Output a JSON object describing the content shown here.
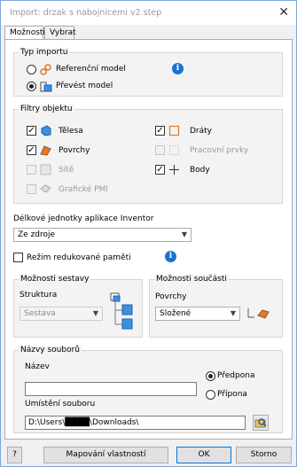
{
  "window": {
    "title": "Import: drzak s nabojnicemi v2.step"
  },
  "tabs": [
    {
      "label": "Možnosti"
    },
    {
      "label": "Vybrat"
    }
  ],
  "import_type": {
    "label": "Typ importu",
    "options": [
      {
        "label": "Referenční model",
        "selected": false
      },
      {
        "label": "Převést model",
        "selected": true
      }
    ]
  },
  "object_filters": {
    "label": "Filtry objektu",
    "items": [
      {
        "label": "Tělesa",
        "checked": true,
        "enabled": true
      },
      {
        "label": "Povrchy",
        "checked": true,
        "enabled": true
      },
      {
        "label": "Sítě",
        "checked": false,
        "enabled": false
      },
      {
        "label": "Grafické PMI",
        "checked": false,
        "enabled": false
      },
      {
        "label": "Dráty",
        "checked": true,
        "enabled": true
      },
      {
        "label": "Pracovní prvky",
        "checked": false,
        "enabled": false
      },
      {
        "label": "Body",
        "checked": true,
        "enabled": true
      }
    ]
  },
  "units": {
    "label": "Délkové jednotky aplikace Inventor",
    "value": "Ze zdroje"
  },
  "reduced_memory": {
    "label": "Režim redukované paměti",
    "checked": false
  },
  "assembly_options": {
    "label": "Možnosti sestavy",
    "structure_label": "Struktura",
    "structure_value": "Sestava"
  },
  "part_options": {
    "label": "Možnosti součásti",
    "surfaces_label": "Povrchy",
    "surfaces_value": "Složené"
  },
  "file_names": {
    "label": "Názvy souborů",
    "name_label": "Název",
    "name_value": "",
    "prefix_label": "Předpona",
    "suffix_label": "Přípona",
    "prefix_selected": true,
    "location_label": "Umístění souboru",
    "location_value": "D:\\Users\\████\\Downloads\\"
  },
  "buttons": {
    "help": "?",
    "mapping": "Mapování vlastností",
    "ok": "OK",
    "cancel": "Storno"
  },
  "icons": {
    "info_color": "#1a73d1",
    "part_color": "#3d8fe0",
    "surface_color": "#e07a2e"
  }
}
